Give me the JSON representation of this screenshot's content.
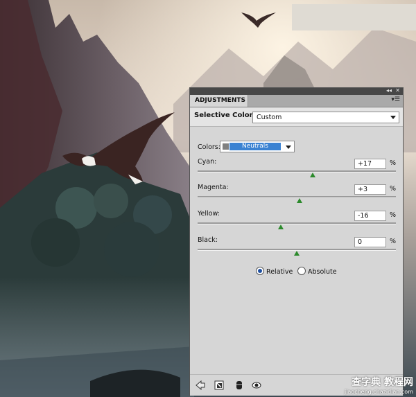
{
  "panel": {
    "collapse_icon": "double-arrow-icon",
    "close_icon": "close-icon",
    "tab_label": "ADJUSTMENTS",
    "menu_icon": "panel-menu-icon",
    "adjustment_title": "Selective Color",
    "preset_value": "Custom",
    "colors_label": "Colors:",
    "colors_value": "Neutrals",
    "sliders": [
      {
        "label": "Cyan:",
        "value": "+17",
        "unit": "%",
        "fraction": 0.58
      },
      {
        "label": "Magenta:",
        "value": "+3",
        "unit": "%",
        "fraction": 0.515
      },
      {
        "label": "Yellow:",
        "value": "-16",
        "unit": "%",
        "fraction": 0.42
      },
      {
        "label": "Black:",
        "value": "0",
        "unit": "%",
        "fraction": 0.5
      }
    ],
    "method": {
      "relative_label": "Relative",
      "absolute_label": "Absolute",
      "selected": "Relative"
    },
    "footer_icons": [
      "back-arrow-icon",
      "clip-to-layer-icon",
      "visibility-eye-icon",
      "view-previous-icon"
    ]
  },
  "watermark": {
    "line1": "查字典 教程网",
    "line2": "jiaocheng.chazidian.com"
  }
}
